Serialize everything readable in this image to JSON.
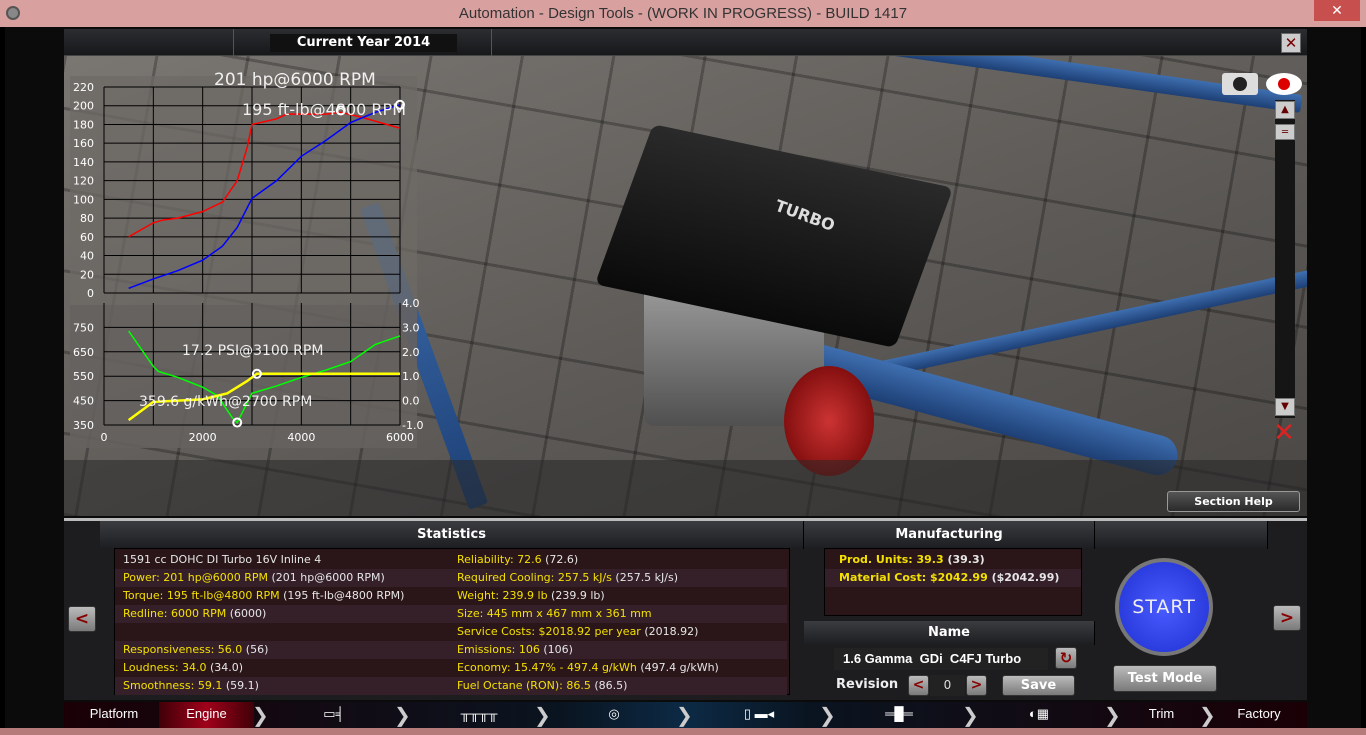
{
  "window": {
    "title": "Automation - Design Tools - (WORK IN PROGRESS) - BUILD 1417"
  },
  "header": {
    "current_year": "Current Year 2014"
  },
  "scene": {
    "engine_cover_text": "TURBO"
  },
  "buttons": {
    "section_help": "Section Help",
    "start": "START",
    "test_mode": "Test Mode",
    "save": "Save",
    "prev": "<",
    "next": ">",
    "close": "✕"
  },
  "statistics": {
    "title": "Statistics",
    "left": [
      {
        "label": "1591 cc DOHC DI Turbo 16V Inline 4",
        "value": ""
      },
      {
        "label": "Power: 201 hp@6000 RPM",
        "value": " (201 hp@6000 RPM)"
      },
      {
        "label": "Torque: 195 ft-lb@4800 RPM",
        "value": " (195 ft-lb@4800 RPM)"
      },
      {
        "label": "Redline: 6000 RPM",
        "value": " (6000)"
      },
      {
        "label": "",
        "value": ""
      },
      {
        "label": "Responsiveness: 56.0",
        "value": " (56)"
      },
      {
        "label": "Loudness: 34.0",
        "value": " (34.0)"
      },
      {
        "label": "Smoothness: 59.1",
        "value": " (59.1)"
      }
    ],
    "right": [
      {
        "label": "Reliability: 72.6",
        "value": " (72.6)"
      },
      {
        "label": "Required Cooling: 257.5 kJ/s",
        "value": " (257.5 kJ/s)"
      },
      {
        "label": "Weight: 239.9 lb",
        "value": " (239.9 lb)"
      },
      {
        "label": "Size: 445 mm x 467 mm x 361 mm",
        "value": ""
      },
      {
        "label": "Service Costs: $2018.92 per year",
        "value": " (2018.92)"
      },
      {
        "label": "Emissions: 106",
        "value": " (106)"
      },
      {
        "label": "Economy: 15.47% - 497.4 g/kWh",
        "value": " (497.4 g/kWh)"
      },
      {
        "label": "Fuel Octane (RON): 86.5",
        "value": " (86.5)"
      }
    ]
  },
  "manufacturing": {
    "title": "Manufacturing",
    "rows": [
      {
        "label": "Prod. Units: 39.3",
        "value": " (39.3)"
      },
      {
        "label": "Material Cost: $2042.99",
        "value": " ($2042.99)"
      }
    ]
  },
  "name_section": {
    "title": "Name",
    "name_value": "1.6 Gamma  GDi  C4FJ Turbo",
    "revision_label": "Revision",
    "revision_value": "0"
  },
  "nav": {
    "items": [
      "Platform",
      "Engine",
      "Trim",
      "Factory"
    ],
    "icon_items": [
      "block-icon",
      "pistons-icon",
      "turbo-icon",
      "fuel-icon",
      "exhaust-icon",
      "tune-icon"
    ],
    "active": "Engine"
  },
  "chart_data": [
    {
      "type": "line",
      "title": "",
      "xlabel": "",
      "ylabel": "",
      "xlim": [
        0,
        6000
      ],
      "ylim": [
        0,
        220
      ],
      "yticks": [
        "0",
        "20",
        "40",
        "60",
        "80",
        "100",
        "120",
        "140",
        "160",
        "180",
        "200",
        "220"
      ],
      "annotations": [
        "201 hp@6000 RPM",
        "195 ft-lb@4800 RPM"
      ],
      "grid": true,
      "series": [
        {
          "color": "#ff0000",
          "x": [
            500,
            1000,
            1200,
            1500,
            2000,
            2400,
            2700,
            2900,
            3000,
            3500,
            3700,
            4000,
            4500,
            4800,
            5200,
            6000
          ],
          "y": [
            60,
            75,
            78,
            80,
            87,
            97,
            120,
            155,
            180,
            186,
            191,
            191,
            191,
            193,
            188,
            176
          ]
        },
        {
          "color": "#0000ff",
          "x": [
            500,
            1000,
            1500,
            2000,
            2400,
            2700,
            3000,
            3500,
            4000,
            4500,
            5000,
            5500,
            6000
          ],
          "y": [
            5,
            15,
            24,
            35,
            50,
            70,
            101,
            120,
            146,
            163,
            182,
            193,
            201
          ]
        }
      ]
    },
    {
      "type": "line",
      "title": "",
      "xlabel": "",
      "ylabel": "",
      "xlim": [
        0,
        6000
      ],
      "ylim": [
        350,
        850
      ],
      "y2lim": [
        -1,
        4
      ],
      "xticks": [
        "0",
        "2000",
        "4000",
        "6000"
      ],
      "yticks": [
        "350",
        "450",
        "550",
        "650",
        "750"
      ],
      "y2ticks": [
        "-1.0",
        "0.0",
        "1.0",
        "2.0",
        "3.0",
        "4.0"
      ],
      "annotations": [
        "17.2 PSI@3100 RPM",
        "359.6 g/kWh@2700 RPM"
      ],
      "grid": true,
      "series": [
        {
          "color": "#00ff00",
          "axis": "left",
          "x": [
            500,
            1000,
            1100,
            1500,
            2000,
            2300,
            2600,
            2700,
            2800,
            3000,
            3500,
            4000,
            4500,
            5000,
            5500,
            6000
          ],
          "y": [
            735,
            590,
            570,
            545,
            505,
            470,
            380,
            360,
            400,
            480,
            510,
            545,
            575,
            610,
            680,
            715
          ]
        },
        {
          "color": "#ffff00",
          "axis": "right",
          "x": [
            500,
            1000,
            1500,
            2000,
            2500,
            2900,
            3100,
            4000,
            6000
          ],
          "y": [
            -0.8,
            -0.05,
            0,
            0.05,
            0.3,
            0.8,
            1.1,
            1.1,
            1.1
          ]
        }
      ]
    }
  ]
}
